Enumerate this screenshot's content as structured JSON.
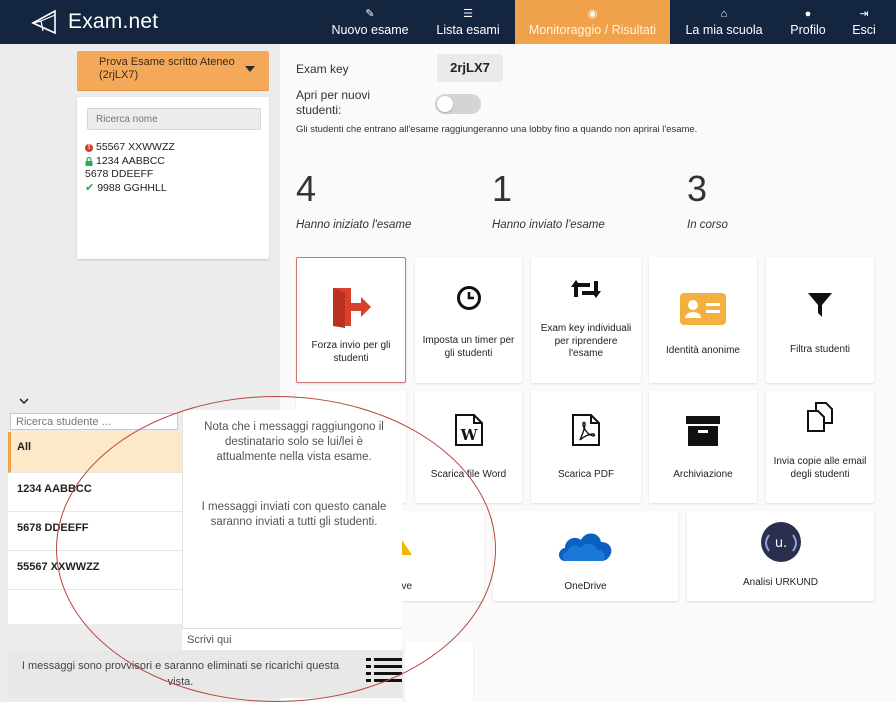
{
  "brand": {
    "name": "Exam.net"
  },
  "nav": [
    {
      "icon": "pencil-icon",
      "glyph": "✎",
      "label": "Nuovo esame"
    },
    {
      "icon": "list-icon",
      "glyph": "☰",
      "label": "Lista esami"
    },
    {
      "icon": "eye-icon",
      "glyph": "◉",
      "label": "Monitoraggio / Risultati",
      "active": true
    },
    {
      "icon": "home-icon",
      "glyph": "⌂",
      "label": "La mia scuola"
    },
    {
      "icon": "user-icon",
      "glyph": "●",
      "label": "Profilo"
    },
    {
      "icon": "sign-out-icon",
      "glyph": "⇥",
      "label": "Esci"
    }
  ],
  "exam_select": {
    "value": "Prova Esame scritto Ateneo (2rjLX7)"
  },
  "name_search": {
    "placeholder": "Ricerca nome"
  },
  "names": [
    {
      "status": "error",
      "text": "55567 XXWWZZ"
    },
    {
      "status": "locked",
      "text": "1234 AABBCC"
    },
    {
      "status": "none",
      "text": "5678 DDEEFF"
    },
    {
      "status": "submitted",
      "text": "9988 GGHHLL"
    }
  ],
  "exam_key": {
    "label": "Exam key",
    "value": "2rjLX7"
  },
  "open_for_new": {
    "label": "Apri per nuovi studenti:",
    "enabled": false
  },
  "lobby_note": "Gli studenti che entrano all'esame raggiungeranno una lobby fino a quando non aprirai l'esame.",
  "stats": [
    {
      "value": "4",
      "label": "Hanno iniziato l'esame"
    },
    {
      "value": "1",
      "label": "Hanno inviato l'esame"
    },
    {
      "value": "3",
      "label": "In corso"
    }
  ],
  "tiles": {
    "force_submit": "Forza invio per gli studenti",
    "timer": "Imposta un timer per gli studenti",
    "individual_keys": "Exam key individuali per riprendere l'esame",
    "anonymous": "Identità anonime",
    "filter": "Filtra studenti",
    "word": "Scarica file Word",
    "pdf": "Scarica PDF",
    "archive": "Archiviazione",
    "email_copies": "Invia copie alle email degli studenti",
    "gdrive_partial": "rive",
    "onedrive": "OneDrive",
    "urkund": "Analisi URKUND"
  },
  "chat": {
    "student_search_placeholder": "Ricerca studente ...",
    "students": [
      "All",
      "1234 AABBCC",
      "5678 DDEEFF",
      "55567 XXWWZZ"
    ],
    "note_1": "Nota che i messaggi raggiungono il destinatario solo se lui/lei è attualmente nella vista esame.",
    "note_2": "I messaggi inviati con questo canale saranno inviati a tutti gli studenti.",
    "write_placeholder": "Scrivi qui",
    "temporary_note": "I messaggi sono provvisori e saranno eliminati se ricarichi questa vista."
  },
  "colors": {
    "nav_bg": "#14253f",
    "accent": "#f0a24b",
    "danger": "#d9412c",
    "success": "#2fa84f",
    "annotation": "#b3463c"
  }
}
